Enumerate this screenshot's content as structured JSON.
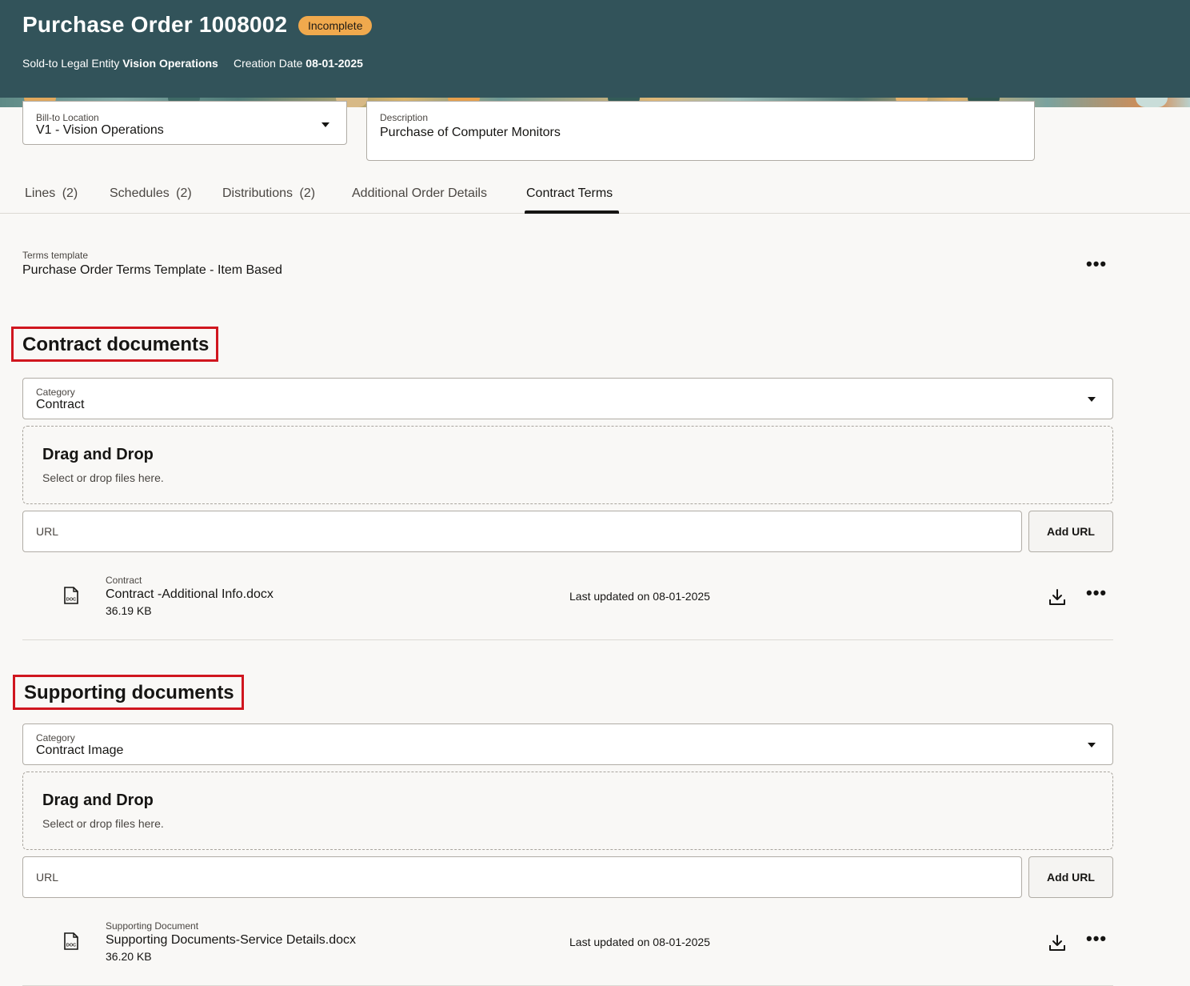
{
  "header": {
    "title": "Purchase Order 1008002",
    "status": "Incomplete",
    "sold_to_label": "Sold-to Legal Entity",
    "sold_to_value": "Vision Operations",
    "creation_date_label": "Creation Date",
    "creation_date_value": "08-01-2025"
  },
  "bill_to": {
    "label": "Bill-to Location",
    "value": "V1 - Vision Operations"
  },
  "description": {
    "label": "Description",
    "value": "Purchase of Computer Monitors"
  },
  "tabs": [
    {
      "label": "Lines",
      "count": "(2)"
    },
    {
      "label": "Schedules",
      "count": "(2)"
    },
    {
      "label": "Distributions",
      "count": "(2)"
    },
    {
      "label": "Additional Order Details",
      "count": ""
    },
    {
      "label": "Contract Terms",
      "count": "",
      "active": true
    }
  ],
  "terms": {
    "label": "Terms template",
    "value": "Purchase Order Terms Template - Item Based"
  },
  "contract_section": {
    "title": "Contract documents",
    "category_label": "Category",
    "category_value": "Contract",
    "dropzone_title": "Drag and Drop",
    "dropzone_sub": "Select or drop files here.",
    "url_placeholder": "URL",
    "add_url_label": "Add URL",
    "file": {
      "category": "Contract",
      "name": "Contract -Additional Info.docx",
      "size": "36.19 KB",
      "updated": "Last updated on 08-01-2025"
    }
  },
  "supporting_section": {
    "title": "Supporting documents",
    "category_label": "Category",
    "category_value": "Contract Image",
    "dropzone_title": "Drag and Drop",
    "dropzone_sub": "Select or drop files here.",
    "url_placeholder": "URL",
    "add_url_label": "Add URL",
    "file": {
      "category": "Supporting Document",
      "name": "Supporting Documents-Service Details.docx",
      "size": "36.20 KB",
      "updated": "Last updated on 08-01-2025"
    }
  },
  "icons": {
    "more": "more-horizontal-icon",
    "download": "download-icon",
    "doc": "doc-file-icon",
    "dropdown": "chevron-down-icon"
  },
  "colors": {
    "header_bg": "#32535a",
    "badge_bg": "#f0a94d",
    "highlight_border": "#d0161f"
  }
}
